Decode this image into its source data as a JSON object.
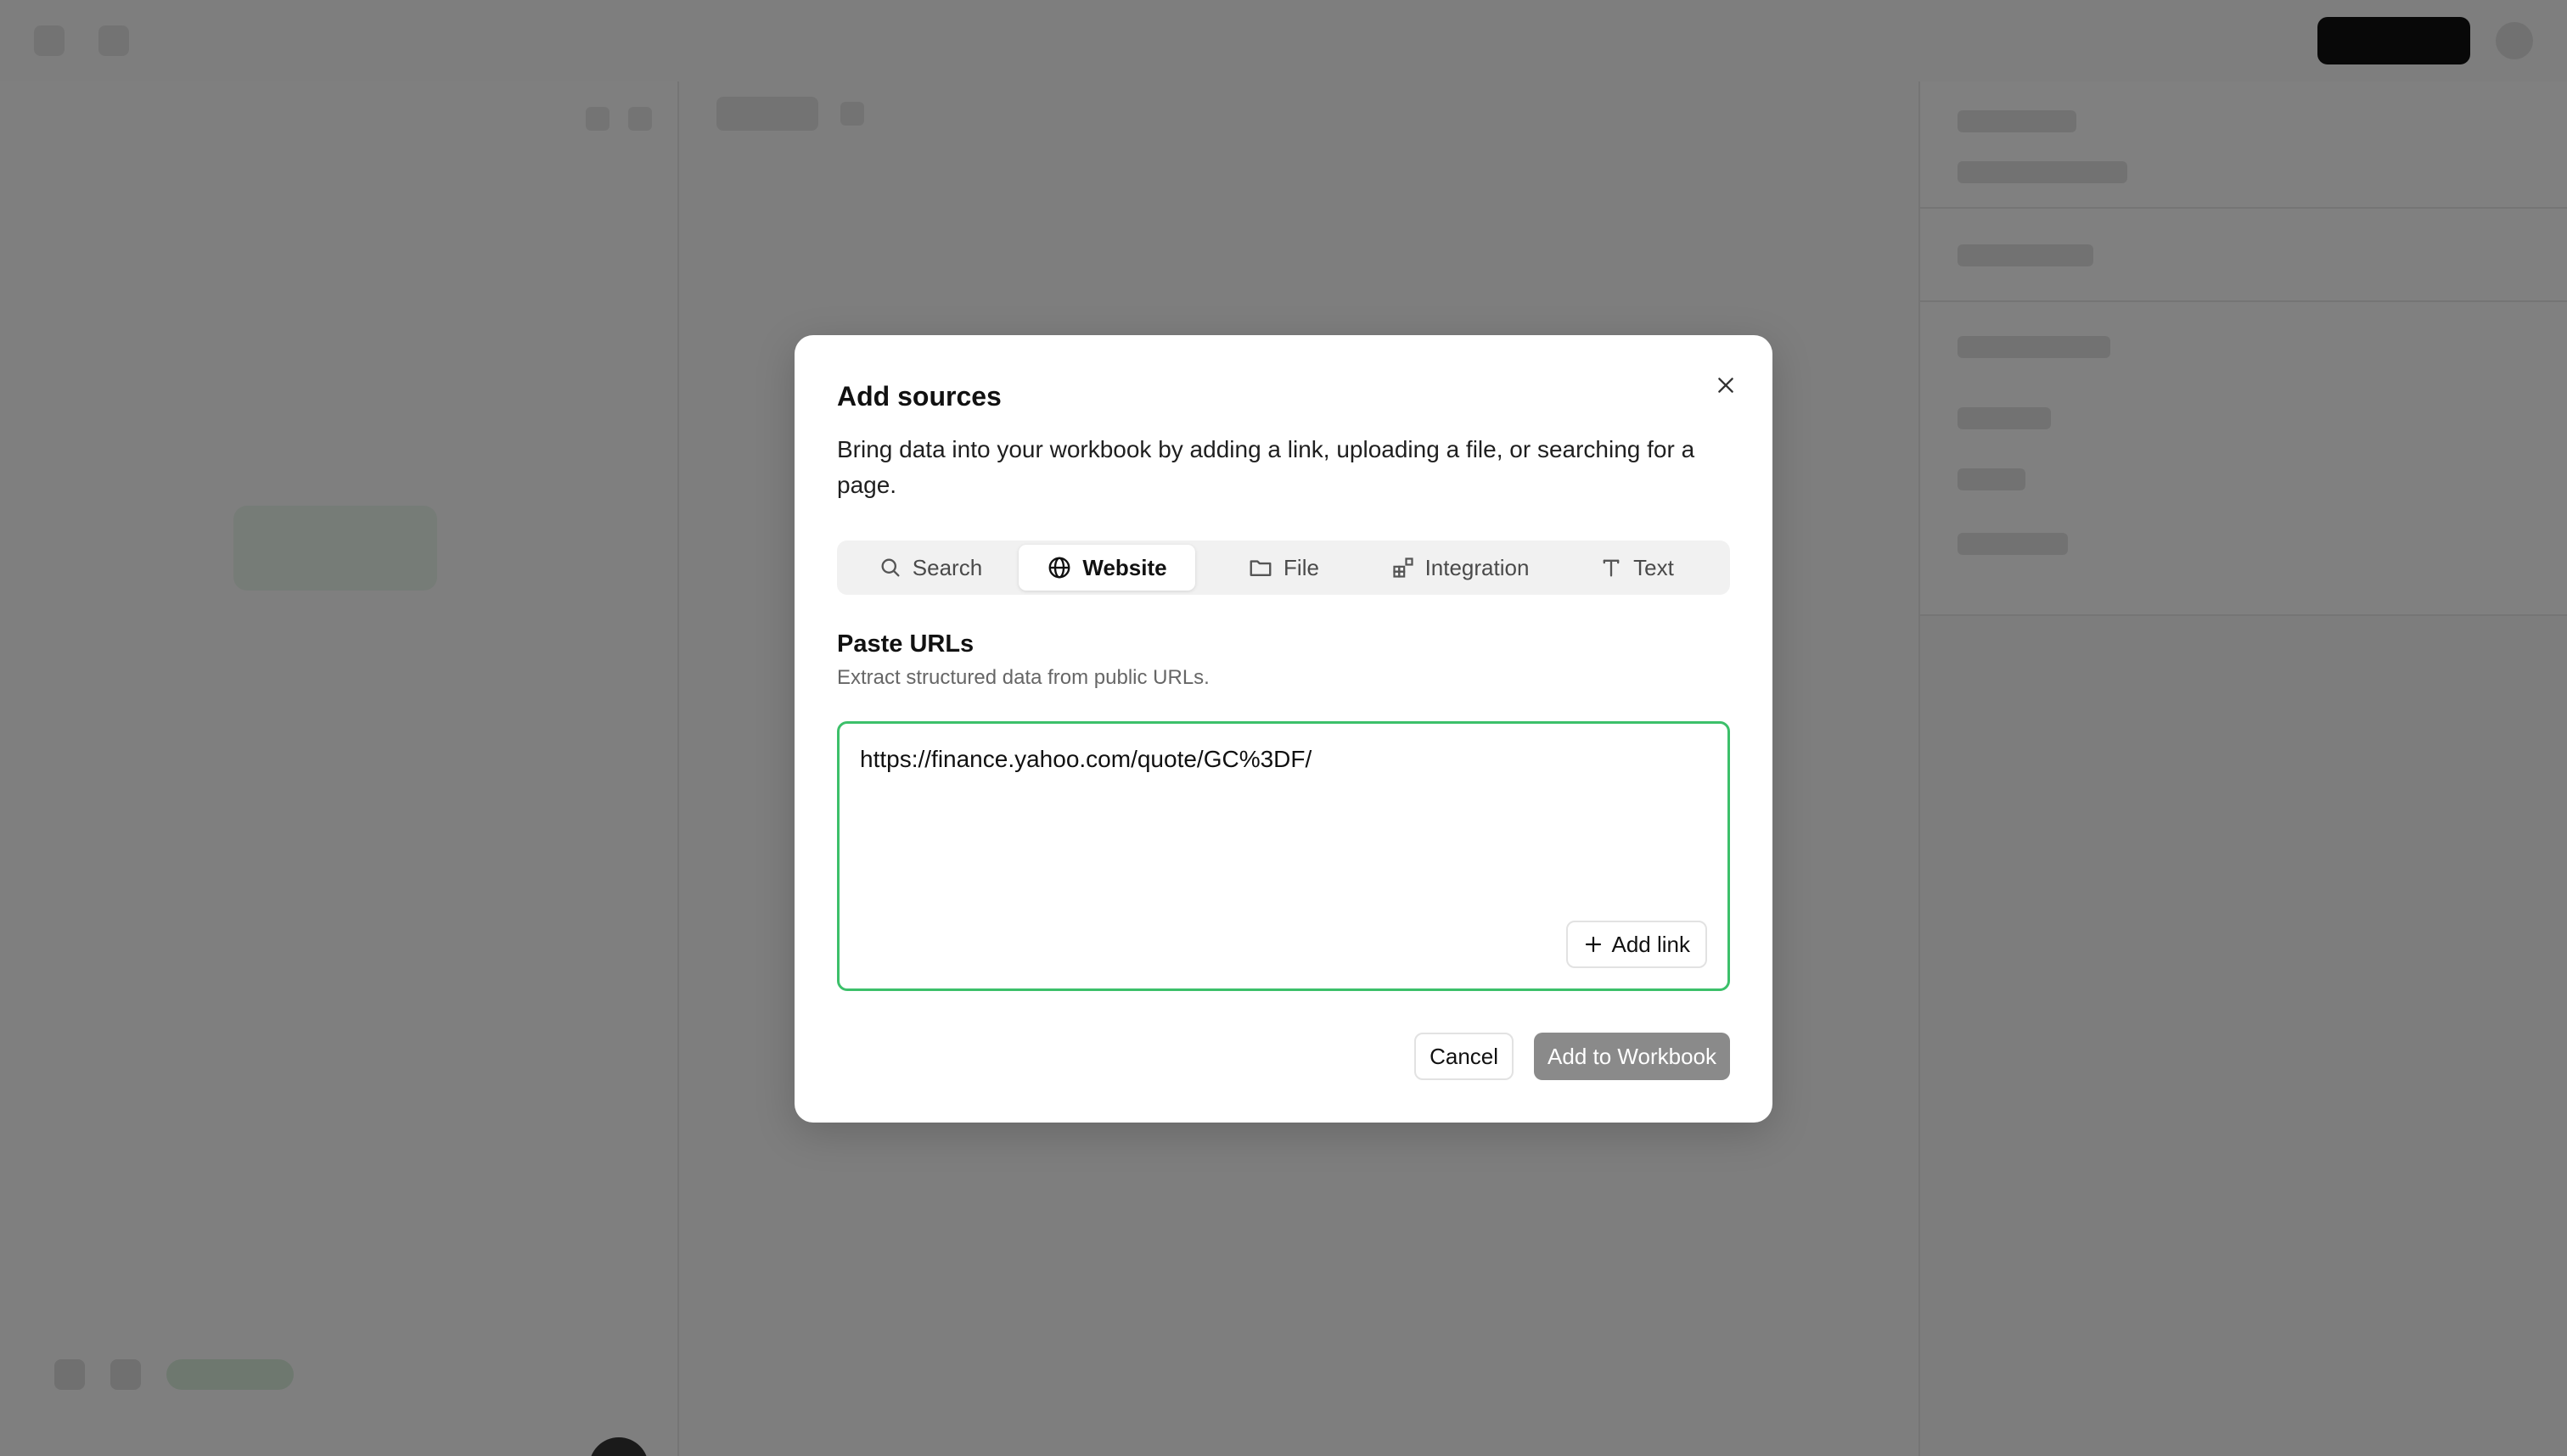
{
  "dialog": {
    "title": "Add sources",
    "description": "Bring data into your workbook by adding a link, uploading a file, or searching for a page.",
    "tabs": [
      {
        "label": "Search",
        "icon": "search-icon",
        "active": false
      },
      {
        "label": "Website",
        "icon": "globe-icon",
        "active": true
      },
      {
        "label": "File",
        "icon": "folder-icon",
        "active": false
      },
      {
        "label": "Integration",
        "icon": "integration-icon",
        "active": false
      },
      {
        "label": "Text",
        "icon": "text-icon",
        "active": false
      }
    ],
    "section_title": "Paste URLs",
    "section_subtitle": "Extract structured data from public URLs.",
    "url_value": "https://finance.yahoo.com/quote/GC%3DF/",
    "add_link_label": "Add link",
    "cancel_label": "Cancel",
    "submit_label": "Add to Workbook"
  },
  "colors": {
    "accent_green": "#3cc06a",
    "overlay": "#000000",
    "submit_disabled": "#8a8a8a"
  }
}
